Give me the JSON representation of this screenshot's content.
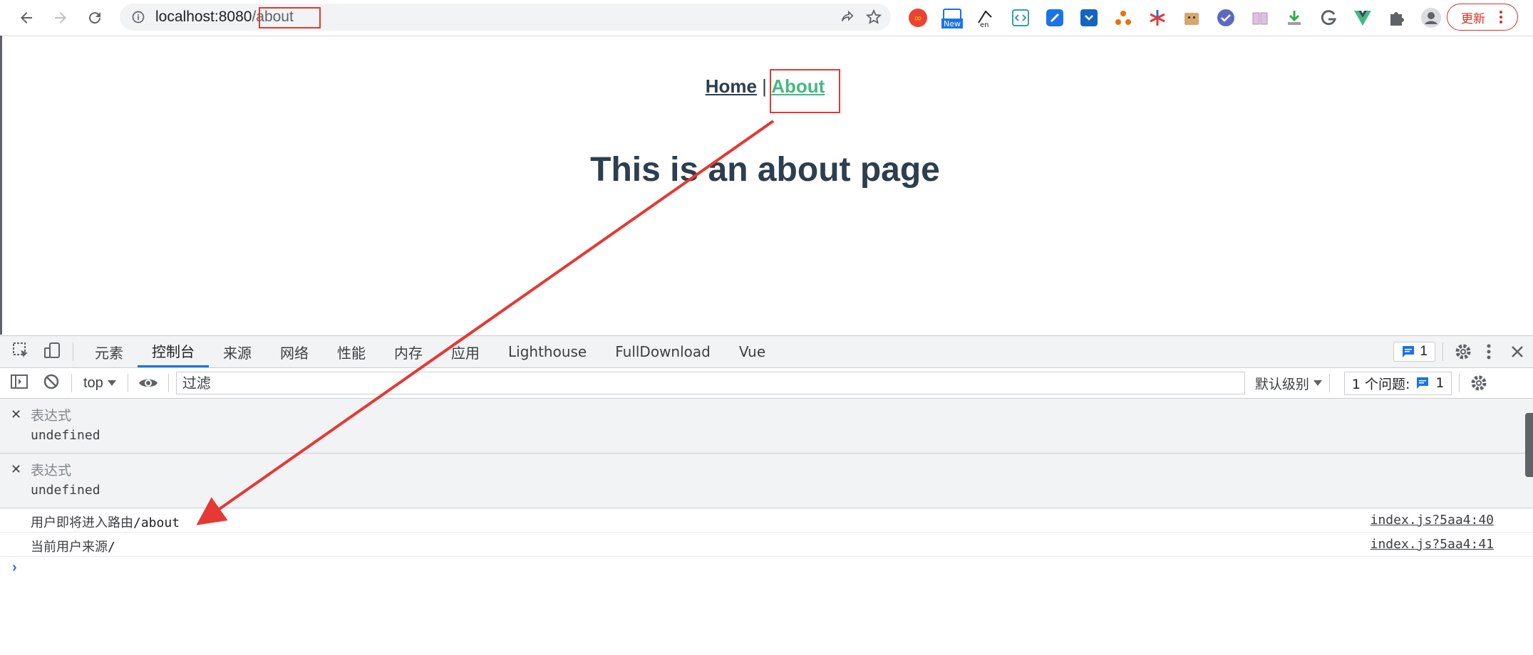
{
  "browser": {
    "url_host": "localhost:8080",
    "url_path": "/about",
    "update_label": "更新",
    "extension_badge_new": "New",
    "extension_label_en": "en",
    "extensions": [
      "infinity-icon",
      "new-tab-icon",
      "translate-icon",
      "code-icon",
      "feather-icon",
      "cloud-download-icon",
      "network-icon",
      "asterisk-icon",
      "bag-icon",
      "checkmark-circle-icon",
      "book-icon",
      "download-icon",
      "g-icon",
      "vue-icon",
      "puzzle-icon",
      "avatar-icon"
    ]
  },
  "page": {
    "nav": {
      "home": "Home",
      "separator": "|",
      "about": "About"
    },
    "heading": "This is an about page"
  },
  "devtools": {
    "tabs": [
      "元素",
      "控制台",
      "来源",
      "网络",
      "性能",
      "内存",
      "应用",
      "Lighthouse",
      "FullDownload",
      "Vue"
    ],
    "active_tab": "控制台",
    "issues_badge_count": "1",
    "context": "top",
    "filter_placeholder": "过滤",
    "levels": "默认级别",
    "issues_label": "1 个问题:",
    "issues_count": "1",
    "expressions": [
      {
        "label": "表达式",
        "value": "undefined"
      },
      {
        "label": "表达式",
        "value": "undefined"
      }
    ],
    "logs": [
      {
        "text": "用户即将进入路由",
        "mono": "/about",
        "source": "index.js?5aa4:40"
      },
      {
        "text": "当前用户来源",
        "mono": "/",
        "source": "index.js?5aa4:41"
      }
    ]
  },
  "colors": {
    "annotation": "#e53935",
    "link_active": "#42b983",
    "heading": "#2c3e50",
    "accent": "#1a73e8"
  }
}
